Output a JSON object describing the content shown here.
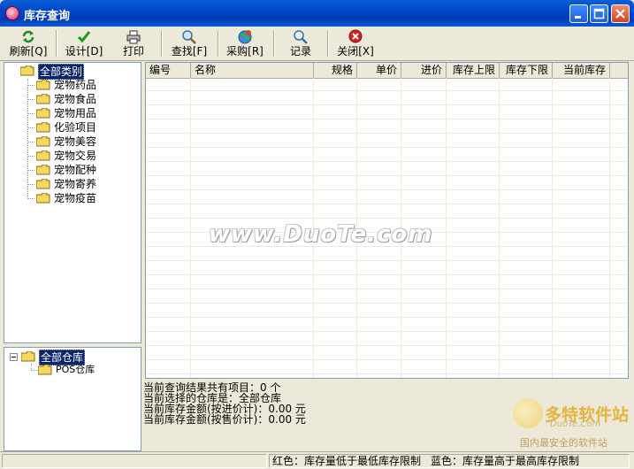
{
  "window": {
    "title": "库存查询"
  },
  "toolbar": {
    "refresh": "刷新[Q]",
    "design": "设计[D]",
    "print": "打印",
    "find": "查找[F]",
    "purchase": "采购[R]",
    "record": "记录",
    "close": "关闭[X]"
  },
  "category_tree": {
    "root": "全部类别",
    "items": [
      "宠物药品",
      "宠物食品",
      "宠物用品",
      "化验项目",
      "宠物美容",
      "宠物交易",
      "宠物配种",
      "宠物寄养",
      "宠物疫苗"
    ]
  },
  "warehouse_tree": {
    "root": "全部仓库",
    "items": [
      "POS仓库"
    ]
  },
  "grid": {
    "columns": [
      "编号",
      "名称",
      "规格",
      "单价",
      "进价",
      "库存上限",
      "库存下限",
      "当前库存"
    ]
  },
  "watermark": "www.DuoTe.com",
  "info": {
    "line1": "当前查询结果共有项目：0 个",
    "line2": "当前选择的仓库是：全部仓库",
    "line3": "当前库存金额(按进价计)：0.00 元",
    "line4": "当前库存金额(按售价计)：0.00 元"
  },
  "logo": {
    "name": "多特软件站",
    "site": "DuoTe.Com",
    "tagline": "国内最安全的软件站"
  },
  "status": {
    "red_note": "红色：库存量低于最低库存限制",
    "blue_note": "蓝色：库存量高于最高库存限制"
  }
}
